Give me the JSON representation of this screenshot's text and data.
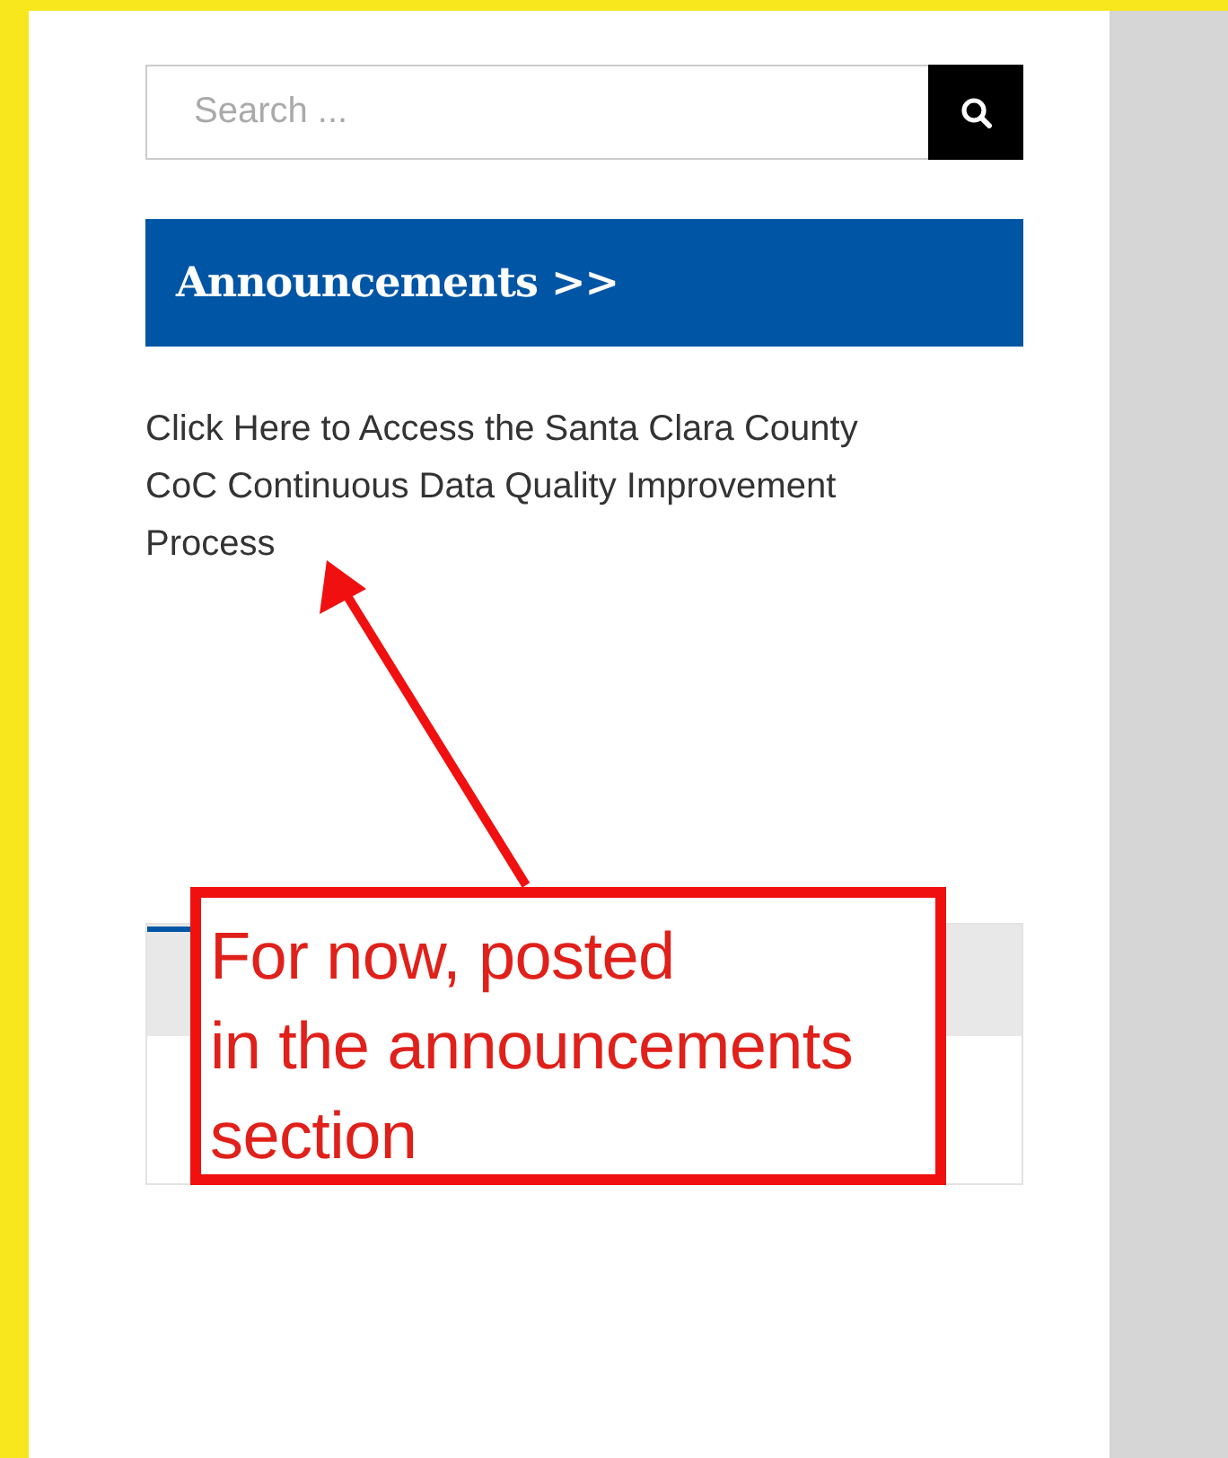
{
  "search": {
    "placeholder": "Search ..."
  },
  "announcements": {
    "title": "Announcements >>",
    "link": "Click Here to Access the Santa Clara County CoC Continuous Data Quality Improvement Process"
  },
  "annotation": {
    "text": "For now, posted\nin the announcements\nsection"
  }
}
